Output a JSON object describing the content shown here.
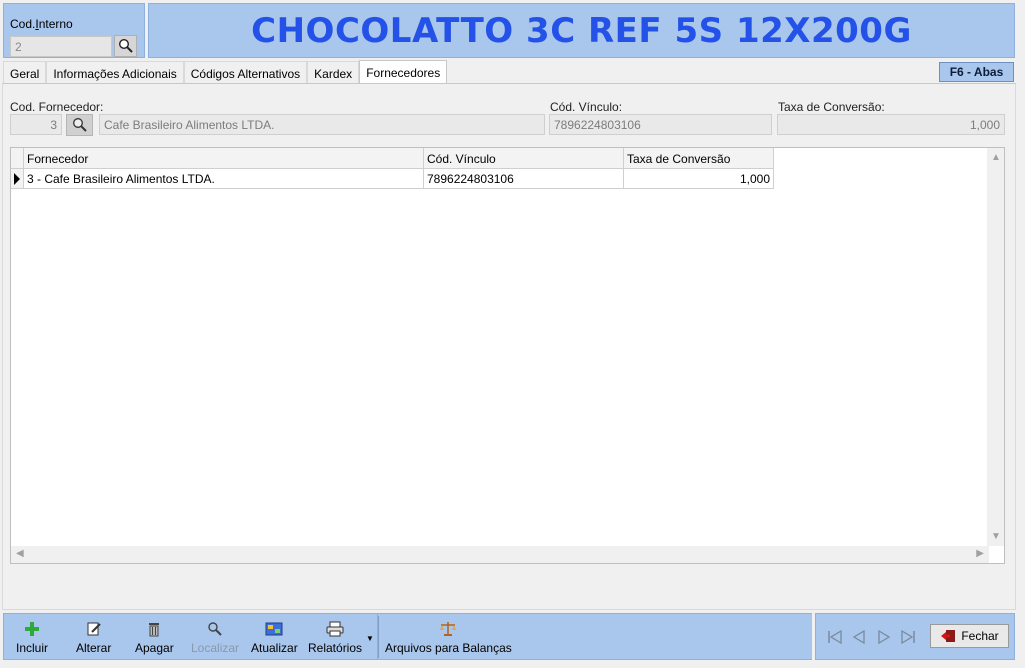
{
  "header": {
    "code_label": "Cod.Interno",
    "code_value": "2",
    "title": "CHOCOLATTO 3C REF 5S 12X200G"
  },
  "tabs": [
    {
      "label": "Geral"
    },
    {
      "label": "Informações Adicionais"
    },
    {
      "label": "Códigos Alternativos"
    },
    {
      "label": "Kardex"
    },
    {
      "label": "Fornecedores",
      "active": true
    }
  ],
  "f6_label": "F6 - Abas",
  "form": {
    "fornecedor_label": "Cod. Fornecedor:",
    "fornecedor_code": "3",
    "fornecedor_name": "Cafe Brasileiro Alimentos LTDA.",
    "vinculo_label": "Cód. Vínculo:",
    "vinculo_value": "7896224803106",
    "taxa_label": "Taxa de Conversão:",
    "taxa_value": "1,000"
  },
  "grid": {
    "columns": [
      "Fornecedor",
      "Cód. Vínculo",
      "Taxa de Conversão"
    ],
    "rows": [
      [
        "3 - Cafe Brasileiro Alimentos LTDA.",
        "7896224803106",
        "1,000"
      ]
    ]
  },
  "toolbar": {
    "incluir": "Incluir",
    "alterar": "Alterar",
    "apagar": "Apagar",
    "localizar": "Localizar",
    "atualizar": "Atualizar",
    "relatorios": "Relatórios",
    "arquivos": "Arquivos para Balanças"
  },
  "close_label": "Fechar",
  "colors": {
    "panel_blue": "#a9c6ec",
    "title_blue": "#2452e8"
  }
}
